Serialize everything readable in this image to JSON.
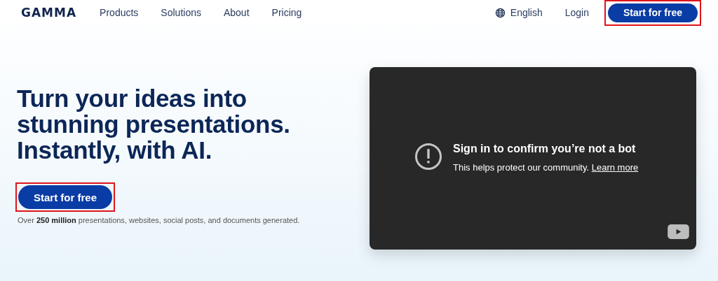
{
  "header": {
    "logo": "GAMMA",
    "nav": [
      "Products",
      "Solutions",
      "About",
      "Pricing"
    ],
    "language": "English",
    "login": "Login",
    "cta": {
      "label": "Start for free",
      "highlighted": true
    }
  },
  "hero": {
    "title_lines": [
      "Turn your ideas into",
      "stunning presentations.",
      "Instantly, with AI."
    ],
    "cta": {
      "label": "Start for free",
      "highlighted": true
    },
    "note": "Over **250 million** presentations, websites, social posts, and documents generated."
  },
  "video": {
    "message_title": "Sign in to confirm you’re not a bot",
    "message_text": "This helps protect our community.",
    "link": "Learn more"
  }
}
